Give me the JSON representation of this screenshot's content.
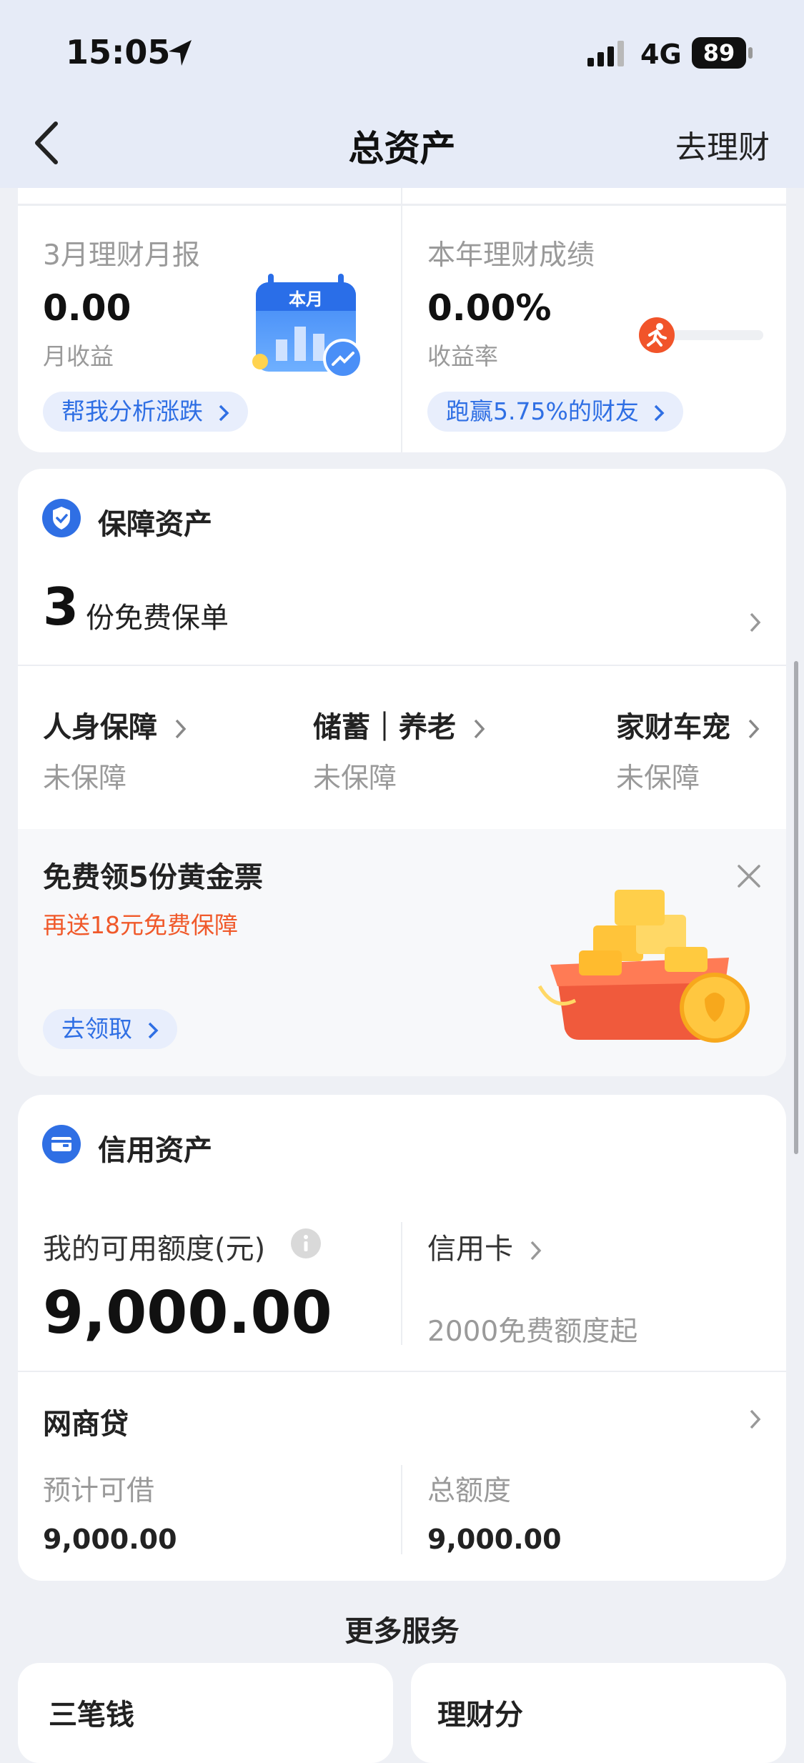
{
  "status": {
    "time": "15:05",
    "network": "4G",
    "battery": "89"
  },
  "nav": {
    "title": "总资产",
    "right_action": "去理财"
  },
  "wealth": {
    "report_title": "3月理财月报",
    "month_value": "0.00",
    "month_label": "月收益",
    "analyze_btn": "帮我分析涨跌",
    "calendar_badge": "本月",
    "year_title": "本年理财成绩",
    "year_value": "0.00%",
    "year_label": "收益率",
    "beat_btn": "跑赢5.75%的财友",
    "accent": "#2f6fe4"
  },
  "insurance": {
    "section_title": "保障资产",
    "count": "3",
    "count_text": "份免费保单",
    "categories": [
      {
        "label": "人身保障",
        "status": "未保障"
      },
      {
        "label": "储蓄｜养老",
        "status": "未保障"
      },
      {
        "label": "家财车宠",
        "status": "未保障"
      }
    ],
    "promo_title": "免费领5份黄金票",
    "promo_subtitle": "再送18元免费保障",
    "promo_btn": "去领取",
    "promo_accent": "#f0592a"
  },
  "credit": {
    "section_title": "信用资产",
    "available_label": "我的可用额度(元)",
    "available_value": "9,000.00",
    "card_label": "信用卡",
    "card_sub": "2000免费额度起",
    "loan_title": "网商贷",
    "loan_left_label": "预计可借",
    "loan_left_value": "9,000.00",
    "loan_right_label": "总额度",
    "loan_right_value": "9,000.00"
  },
  "more": {
    "title": "更多服务",
    "items": [
      "三笔钱",
      "理财分"
    ]
  }
}
